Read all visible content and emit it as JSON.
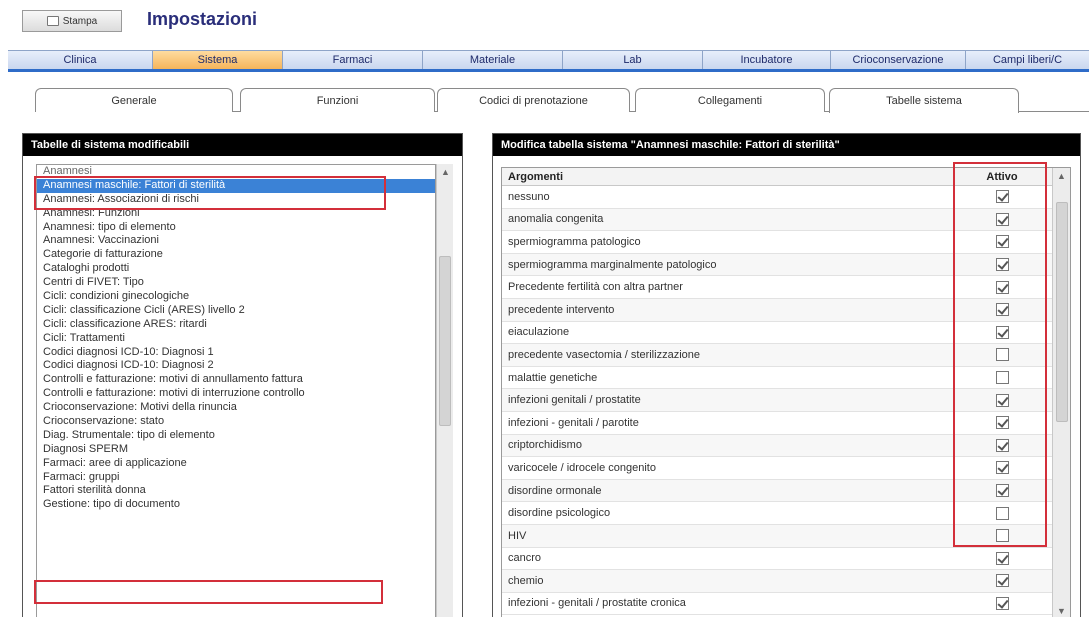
{
  "header": {
    "print_label": "Stampa",
    "title": "Impostazioni"
  },
  "main_tabs": [
    {
      "label": "Clinica"
    },
    {
      "label": "Sistema"
    },
    {
      "label": "Farmaci"
    },
    {
      "label": "Materiale"
    },
    {
      "label": "Lab"
    },
    {
      "label": "Incubatore"
    },
    {
      "label": "Crioconservazione"
    },
    {
      "label": "Campi liberi/C"
    }
  ],
  "sub_tabs": [
    {
      "label": "Generale"
    },
    {
      "label": "Funzioni"
    },
    {
      "label": "Codici di prenotazione"
    },
    {
      "label": "Collegamenti"
    },
    {
      "label": "Tabelle sistema"
    }
  ],
  "left_panel": {
    "title": "Tabelle di sistema modificabili",
    "items": [
      "Anamnesi",
      "Anamnesi maschile: Fattori di sterilità",
      "Anamnesi: Associazioni di rischi",
      "Anamnesi: Funzioni",
      "Anamnesi: tipo di elemento",
      "Anamnesi: Vaccinazioni",
      "Categorie di fatturazione",
      "Cataloghi prodotti",
      "Centri di FIVET: Tipo",
      "Cicli: condizioni ginecologiche",
      "Cicli: classificazione Cicli (ARES) livello 2",
      "Cicli: classificazione ARES: ritardi",
      "Cicli: Trattamenti",
      "Codici diagnosi ICD-10: Diagnosi 1",
      "Codici diagnosi ICD-10: Diagnosi 2",
      "Controlli e fatturazione: motivi di annullamento fattura",
      "Controlli e fatturazione: motivi di interruzione controllo",
      "Crioconservazione: Motivi della rinuncia",
      "Crioconservazione: stato",
      "Diag. Strumentale: tipo di elemento",
      "Diagnosi SPERM",
      "Farmaci: aree di applicazione",
      "Farmaci: gruppi",
      "Fattori sterilità donna",
      "Gestione: tipo di documento"
    ]
  },
  "right_panel": {
    "title": "Modifica tabella sistema \"Anamnesi maschile: Fattori di sterilità\"",
    "col_topic": "Argomenti",
    "col_active": "Attivo",
    "rows": [
      {
        "label": "nessuno",
        "active": true
      },
      {
        "label": "anomalia congenita",
        "active": true
      },
      {
        "label": "spermiogramma patologico",
        "active": true
      },
      {
        "label": "spermiogramma marginalmente patologico",
        "active": true
      },
      {
        "label": "Precedente fertilità con altra partner",
        "active": true
      },
      {
        "label": "precedente intervento",
        "active": true
      },
      {
        "label": "eiaculazione",
        "active": true
      },
      {
        "label": "precedente vasectomia / sterilizzazione",
        "active": false
      },
      {
        "label": "malattie genetiche",
        "active": false
      },
      {
        "label": "infezioni genitali / prostatite",
        "active": true
      },
      {
        "label": "infezioni - genitali / parotite",
        "active": true
      },
      {
        "label": "criptorchidismo",
        "active": true
      },
      {
        "label": "varicocele / idrocele congenito",
        "active": true
      },
      {
        "label": "disordine ormonale",
        "active": true
      },
      {
        "label": "disordine psicologico",
        "active": false
      },
      {
        "label": "HIV",
        "active": false
      },
      {
        "label": "cancro",
        "active": true
      },
      {
        "label": "chemio",
        "active": true
      },
      {
        "label": "infezioni - genitali / prostatite cronica",
        "active": true
      }
    ]
  },
  "colors": {
    "accent_blue": "#3b82d6",
    "active_tab": "#f6b45a",
    "highlight_red": "#d32f3a"
  }
}
